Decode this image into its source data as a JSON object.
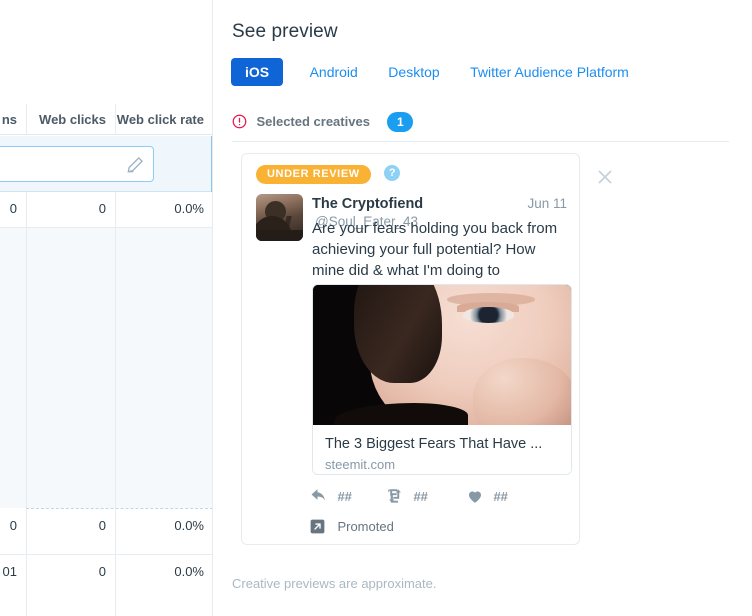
{
  "table": {
    "headers": [
      "ns",
      "Web clicks",
      "Web click rate"
    ],
    "edit_row": {
      "icon": "edit-pencil-icon",
      "value": ""
    },
    "rows": [
      {
        "c0": "0",
        "c1": "0",
        "c2": "0.0%"
      },
      {
        "c0": "0",
        "c1": "0",
        "c2": "0.0%"
      },
      {
        "c0": "01",
        "c1": "0",
        "c2": "0.0%"
      }
    ]
  },
  "preview": {
    "title": "See preview",
    "tabs": [
      {
        "label": "iOS",
        "active": true
      },
      {
        "label": "Android",
        "active": false
      },
      {
        "label": "Desktop",
        "active": false
      },
      {
        "label": "Twitter Audience Platform",
        "active": false
      }
    ],
    "selected_creatives": {
      "icon": "alert-circle-icon",
      "label": "Selected creatives",
      "count": "1"
    },
    "footnote": "Creative previews are approximate.",
    "close_icon": "close-icon"
  },
  "tweet": {
    "status_badge": "UNDER REVIEW",
    "help_icon": "?",
    "author_name": "The Cryptofiend",
    "author_handle": "@Soul_Eater_43",
    "date": "Jun 11",
    "text": "Are your fears holding you back from achieving your full potential? How mine did & what I'm doing to overcome them:",
    "link_card": {
      "title": "The 3 Biggest Fears That Have ...",
      "domain": "steemit.com",
      "image_alt": "woman-portrait-photo"
    },
    "actions": [
      {
        "icon": "reply-icon",
        "count": "##"
      },
      {
        "icon": "retweet-icon",
        "count": "##"
      },
      {
        "icon": "heart-icon",
        "count": "##"
      }
    ],
    "promoted": {
      "icon": "promoted-arrow-icon",
      "label": "Promoted"
    }
  },
  "colors": {
    "accent_blue": "#0f64d6",
    "link_blue": "#1b8ef2",
    "badge_blue": "#1b9df0",
    "warn_orange": "#f9b233",
    "alert_red": "#e8174a",
    "text_dark": "#2a3b47",
    "text_muted": "#8899a6"
  }
}
